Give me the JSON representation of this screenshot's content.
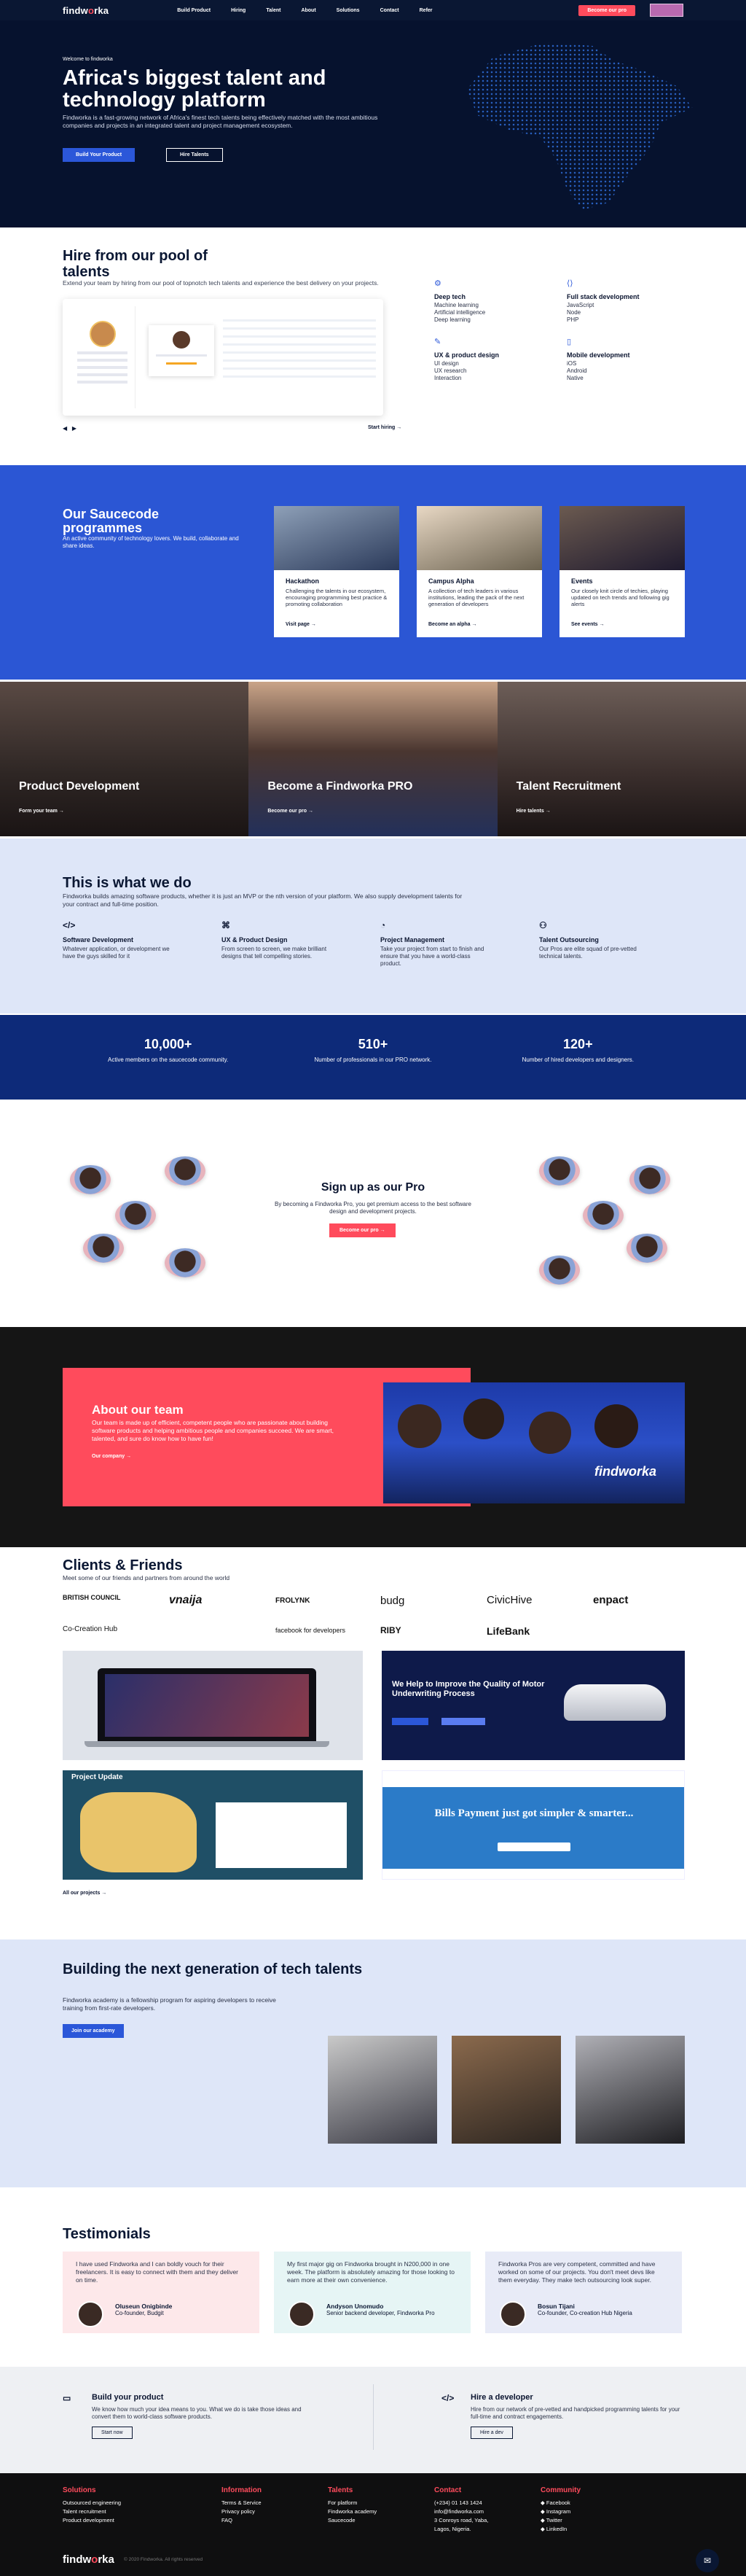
{
  "nav": {
    "logo_left": "findw",
    "logo_o": "o",
    "logo_right": "rka",
    "items": [
      "Build Product",
      "Hiring",
      "Talent",
      "About",
      "Solutions",
      "Contact",
      "Refer"
    ],
    "cta": "Become our pro"
  },
  "hero": {
    "welcome": "Welcome to findworka",
    "title": "Africa's biggest talent and technology platform",
    "description": "Findworka is a fast-growing network of Africa's finest tech talents being effectively matched with the most ambitious companies and projects in an integrated talent and project management ecosystem.",
    "btn_primary": "Build Your Product",
    "btn_secondary": "Hire Talents"
  },
  "hire": {
    "title": "Hire from our pool of talents",
    "description": "Extend your team by hiring from our pool of topnotch tech talents and experience the best delivery on your projects.",
    "start_hiring": "Start hiring →",
    "prev": "◀",
    "next": "▶",
    "categories": [
      {
        "title": "Deep tech",
        "items": [
          "Machine learning",
          "Artificial intelligence",
          "Deep learning"
        ]
      },
      {
        "title": "Full stack development",
        "items": [
          "JavaScript",
          "Node",
          "PHP"
        ]
      },
      {
        "title": "UX & product design",
        "items": [
          "UI design",
          "UX research",
          "Interaction"
        ]
      },
      {
        "title": "Mobile development",
        "items": [
          "iOS",
          "Android",
          "Native"
        ]
      }
    ]
  },
  "sauce": {
    "title": "Our Saucecode programmes",
    "description": "An active community of technology lovers. We build, collaborate and share ideas.",
    "cards": [
      {
        "title": "Hackathon",
        "text": "Challenging the talents in our ecosystem, encouraging programming best practice & promoting collaboration",
        "link": "Visit page →"
      },
      {
        "title": "Campus Alpha",
        "text": "A collection of tech leaders in various institutions, leading the pack of the next generation of developers",
        "link": "Become an alpha →"
      },
      {
        "title": "Events",
        "text": "Our closely knit circle of techies, playing updated on tech trends and following gig alerts",
        "link": "See events →"
      }
    ]
  },
  "banner": [
    {
      "title": "Product Development",
      "link": "Form your team →"
    },
    {
      "title": "Become a Findworka PRO",
      "link": "Become our pro →"
    },
    {
      "title": "Talent Recruitment",
      "link": "Hire talents →"
    }
  ],
  "wwd": {
    "title": "This is what we do",
    "description": "Findworka builds amazing software products, whether it is just an MVP or the nth version of your platform. We also supply development talents for your contract and full-time position.",
    "services": [
      {
        "icon": "</>",
        "title": "Software Development",
        "text": "Whatever application, or development we have the guys skilled for it"
      },
      {
        "icon": "⌘",
        "title": "UX & Product Design",
        "text": "From screen to screen, we make brilliant designs that tell compelling stories."
      },
      {
        "icon": "◔",
        "title": "Project Management",
        "text": "Take your project from start to finish and ensure that you have a world-class product."
      },
      {
        "icon": "⚇",
        "title": "Talent Outsourcing",
        "text": "Our Pros are elite squad of pre-vetted technical talents."
      }
    ]
  },
  "stats": [
    {
      "number": "10,000+",
      "label": "Active members on the saucecode community."
    },
    {
      "number": "510+",
      "label": "Number of professionals in our PRO network."
    },
    {
      "number": "120+",
      "label": "Number of hired developers and designers."
    }
  ],
  "pro": {
    "title": "Sign up as our Pro",
    "description": "By becoming a Findworka Pro, you get premium access to the best software design and development projects.",
    "button": "Become our pro →"
  },
  "about": {
    "title": "About our team",
    "description": "Our team is made up of efficient, competent people who are passionate about building software products and helping ambitious people and companies succeed. We are smart, talented, and sure do know how to have fun!",
    "link": "Our company →"
  },
  "clients": {
    "title": "Clients & Friends",
    "description": "Meet some of our friends and partners from around the world",
    "logos": [
      "BRITISH COUNCIL",
      "vnaija",
      "FROLYNK",
      "budg",
      "CivicHive",
      "enpact",
      "Co-Creation Hub",
      "facebook for developers",
      "RIBY",
      "LifeBank"
    ],
    "all_projects": "All our projects →",
    "project_texts": {
      "motor_title": "We Help to Improve the Quality of Motor Underwriting Process",
      "bills_title": "Bills Payment just got simpler & smarter...",
      "tracka_title": "Project Update"
    }
  },
  "academy": {
    "title": "Building the next generation of tech talents",
    "description": "Findworka academy is a fellowship program for aspiring developers to receive training from first-rate developers.",
    "button": "Join our academy"
  },
  "testimonials": {
    "title": "Testimonials",
    "items": [
      {
        "quote": "I have used Findworka and I can boldly vouch for their freelancers. It is easy to connect with them and they deliver on time.",
        "name": "Oluseun Onigbinde",
        "role": "Co-founder, Budgit",
        "bg": "#fde8ea"
      },
      {
        "quote": "My first major gig on Findworka brought in N200,000 in one week. The platform is absolutely amazing for those looking to earn more at their own convenience.",
        "name": "Andyson Unomudo",
        "role": "Senior backend developer, Findworka Pro",
        "bg": "#e6f5f5"
      },
      {
        "quote": "Findworka Pros are very competent, committed and have worked on some of our projects. You don't meet devs like them everyday. They make tech outsourcing look super.",
        "name": "Bosun Tijani",
        "role": "Co-founder, Co-creation Hub Nigeria",
        "bg": "#e8ebf7"
      }
    ]
  },
  "cta": [
    {
      "icon": "▭",
      "title": "Build your product",
      "text": "We know how much your idea means to you. What we do is take those ideas and convert them to world-class software products.",
      "button": "Start now"
    },
    {
      "icon": "</>",
      "title": "Hire a developer",
      "text": "Hire from our network of pre-vetted and handpicked programming talents for your full-time and contract engagements.",
      "button": "Hire a dev"
    }
  ],
  "footer": {
    "columns": [
      {
        "title": "Solutions",
        "items": [
          "Outsourced engineering",
          "Talent recruitment",
          "Product development"
        ]
      },
      {
        "title": "Information",
        "items": [
          "Terms & Service",
          "Privacy policy",
          "FAQ"
        ]
      },
      {
        "title": "Talents",
        "items": [
          "For platform",
          "Findworka academy",
          "Saucecode"
        ]
      },
      {
        "title": "Contact",
        "items": [
          "(+234) 01 143 1424",
          "info@findworka.com",
          "3 Conroys road, Yaba,",
          "Lagos, Nigeria."
        ]
      },
      {
        "title": "Community",
        "items": [
          "Facebook",
          "Instagram",
          "Twitter",
          "LinkedIn"
        ]
      }
    ],
    "copyright": "© 2020 Findworka. All rights reserved"
  },
  "colors": {
    "navy": "#06122e",
    "blue": "#2b57d9",
    "red": "#ff4b5c",
    "light_blue": "#dee6f8"
  }
}
